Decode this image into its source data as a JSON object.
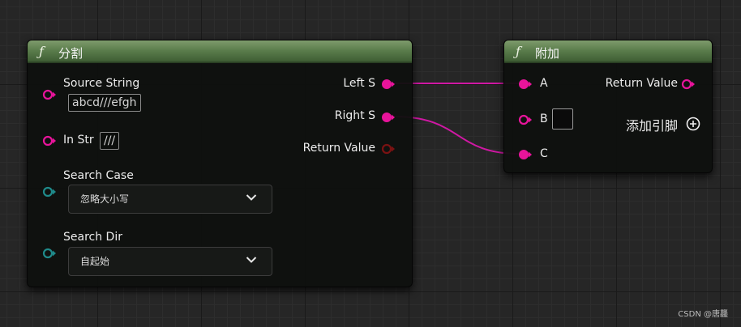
{
  "colors": {
    "string_pin": "#e8149b",
    "enum_pin": "#1f8a8a",
    "wire": "#d018a4",
    "return_disconnected": "#7a1212"
  },
  "split_node": {
    "icon": "function-icon",
    "icon_glyph": "ƒ",
    "title": "分割",
    "inputs": {
      "source_string": {
        "label": "Source String",
        "value": "abcd///efgh"
      },
      "in_str": {
        "label": "In Str",
        "value": "///"
      },
      "search_case": {
        "label": "Search Case",
        "selected": "忽略大小写"
      },
      "search_dir": {
        "label": "Search Dir",
        "selected": "自起始"
      }
    },
    "outputs": {
      "left_s": "Left S",
      "right_s": "Right S",
      "return_value": "Return Value"
    }
  },
  "append_node": {
    "icon": "function-icon",
    "icon_glyph": "ƒ",
    "title": "附加",
    "inputs": {
      "a": "A",
      "b": "B",
      "c": "C"
    },
    "outputs": {
      "return_value": "Return Value"
    },
    "add_pin_label": "添加引脚"
  },
  "watermark": "CSDN @唐龘"
}
